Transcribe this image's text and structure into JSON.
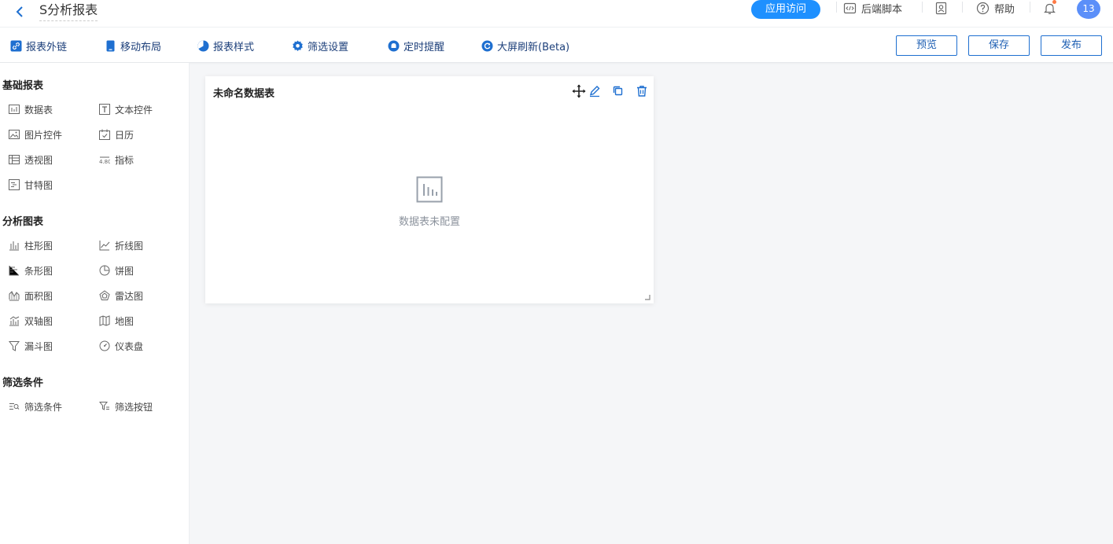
{
  "header": {
    "title": "S分析报表",
    "visit_button": "应用访问",
    "script_label": "后端脚本",
    "help_label": "帮助",
    "avatar_text": "13"
  },
  "toolbar": {
    "items": [
      "报表外链",
      "移动布局",
      "报表样式",
      "筛选设置",
      "定时提醒",
      "大屏刷新(Beta)"
    ],
    "preview": "预览",
    "save": "保存",
    "publish": "发布",
    "accent": "#1e6fd0"
  },
  "sidebar": {
    "sections": [
      {
        "title": "基础报表",
        "items": [
          {
            "label": "数据表",
            "icon": "table-icon"
          },
          {
            "label": "文本控件",
            "icon": "text-icon"
          },
          {
            "label": "图片控件",
            "icon": "image-icon"
          },
          {
            "label": "日历",
            "icon": "calendar-icon"
          },
          {
            "label": "透视图",
            "icon": "pivot-icon"
          },
          {
            "label": "指标",
            "icon": "metric-icon"
          },
          {
            "label": "甘特图",
            "icon": "gantt-icon"
          }
        ]
      },
      {
        "title": "分析图表",
        "items": [
          {
            "label": "柱形图",
            "icon": "column-chart-icon"
          },
          {
            "label": "折线图",
            "icon": "line-chart-icon"
          },
          {
            "label": "条形图",
            "icon": "bar-chart-icon"
          },
          {
            "label": "饼图",
            "icon": "pie-chart-icon"
          },
          {
            "label": "面积图",
            "icon": "area-chart-icon"
          },
          {
            "label": "雷达图",
            "icon": "radar-chart-icon"
          },
          {
            "label": "双轴图",
            "icon": "dual-axis-icon"
          },
          {
            "label": "地图",
            "icon": "map-icon"
          },
          {
            "label": "漏斗图",
            "icon": "funnel-icon"
          },
          {
            "label": "仪表盘",
            "icon": "gauge-icon"
          }
        ]
      },
      {
        "title": "筛选条件",
        "items": [
          {
            "label": "筛选条件",
            "icon": "filter-condition-icon"
          },
          {
            "label": "筛选按钮",
            "icon": "filter-button-icon"
          }
        ]
      }
    ]
  },
  "widget": {
    "title": "未命名数据表",
    "empty_text": "数据表未配置"
  }
}
